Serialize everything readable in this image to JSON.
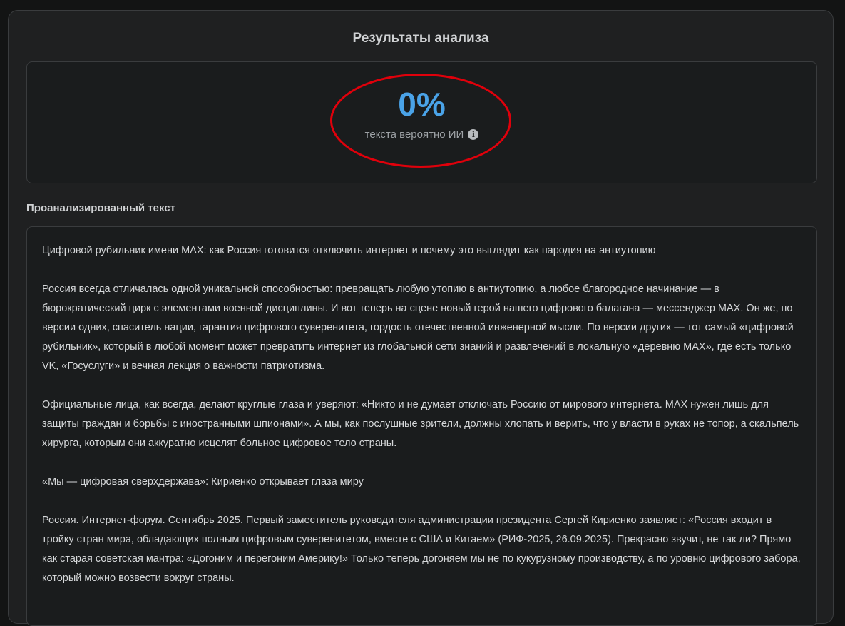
{
  "results": {
    "title": "Результаты анализа",
    "score": "0%",
    "caption": "текста вероятно ИИ",
    "info_icon": "info-icon",
    "highlight_color": "#e0000b",
    "score_color": "#4aa3e8"
  },
  "analyzed": {
    "label": "Проанализированный текст",
    "paragraphs": [
      "Цифровой рубильник имени MAX: как Россия готовится отключить интернет и почему это выглядит как пародия на антиутопию",
      "Россия всегда отличалась одной уникальной способностью: превращать любую утопию в антиутопию, а любое благородное начинание — в бюрократический цирк с элементами военной дисциплины. И вот теперь на сцене новый герой нашего цифрового балагана — мессенджер MAX. Он же, по версии одних, спаситель нации, гарантия цифрового суверенитета, гордость отечественной инженерной мысли. По версии других — тот самый «цифровой рубильник», который в любой момент может превратить интернет из глобальной сети знаний и развлечений в локальную «деревню MAX», где есть только VK, «Госуслуги» и вечная лекция о важности патриотизма.",
      "Официальные лица, как всегда, делают круглые глаза и уверяют: «Никто и не думает отключать Россию от мирового интернета. MAX нужен лишь для защиты граждан и борьбы с иностранными шпионами». А мы, как послушные зрители, должны хлопать и верить, что у власти в руках не топор, а скальпель хирурга, которым они аккуратно исцелят больное цифровое тело страны.",
      "«Мы — цифровая сверхдержава»: Кириенко открывает глаза миру",
      "Россия. Интернет-форум. Сентябрь 2025. Первый заместитель руководителя администрации президента Сергей Кириенко заявляет: «Россия входит в тройку стран мира, обладающих полным цифровым суверенитетом, вместе с США и Китаем» (РИФ-2025, 26.09.2025). Прекрасно звучит, не так ли? Прямо как старая советская мантра: «Догоним и перегоним Америку!» Только теперь догоняем мы не по кукурузному производству, а по уровню цифрового забора, который можно возвести вокруг страны."
    ]
  }
}
